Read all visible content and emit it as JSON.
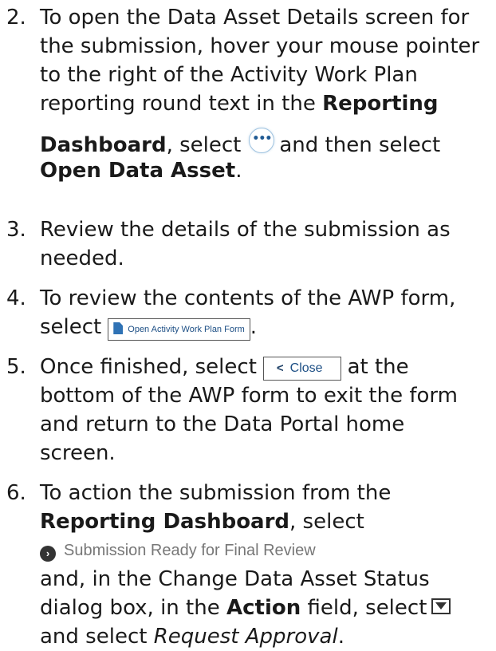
{
  "steps": [
    {
      "number": "2.",
      "l1": "To open the Data Asset Details screen for",
      "l2": "the submission, hover your mouse pointer",
      "l3": "to the right of the Activity Work Plan",
      "l4a": "reporting round text in the ",
      "l4b": "Reporting",
      "l5a": "Dashboard",
      "l5b": ", select",
      "l5c": "and then select",
      "l6a": "Open Data Asset",
      "l6b": "."
    },
    {
      "number": "3.",
      "l1": "Review the details of the submission as",
      "l2": "needed."
    },
    {
      "number": "4.",
      "l1": "To review the contents of the AWP form,",
      "l2": "select",
      "button_label": "Open Activity Work Plan Form",
      "l2end": "."
    },
    {
      "number": "5.",
      "l1a": "Once finished, select",
      "close_label": "Close",
      "l1b": "at the",
      "l2": "bottom of the AWP form to exit the form",
      "l3": "and return to the Data Portal home",
      "l4": "screen."
    },
    {
      "number": "6.",
      "l1": "To action the submission from the",
      "l2a": "Reporting Dashboard",
      "l2b": ", select",
      "status_label": "Submission Ready for Final Review",
      "l4": "and, in the Change Data Asset Status",
      "l5a": "dialog box, in the ",
      "l5b": "Action",
      "l5c": " field, select",
      "l6a": "and select ",
      "l6b": "Request Approval",
      "l6c": "."
    }
  ],
  "icons": {
    "more": "more-options-icon",
    "document": "document-icon",
    "chevron": "chevron-left-icon",
    "status": "chevron-right-circle-icon",
    "dropdown": "dropdown-arrow-icon"
  }
}
